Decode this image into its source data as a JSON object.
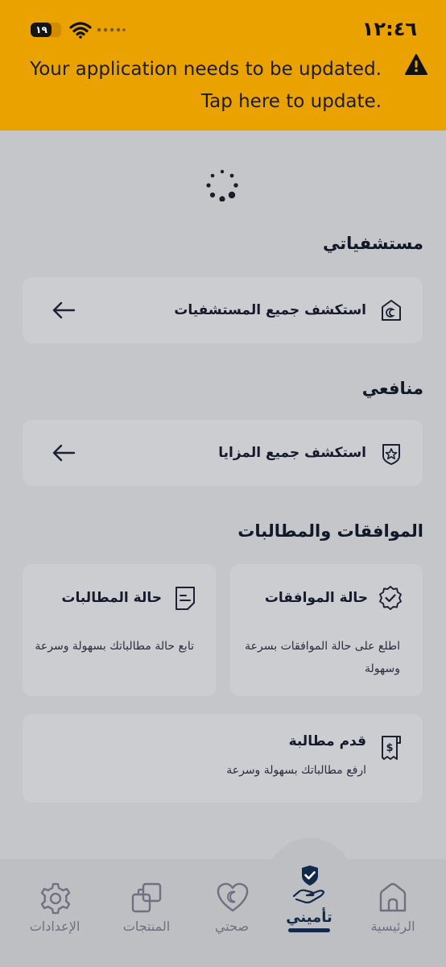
{
  "status_bar": {
    "time": "١٢:٤٦",
    "battery": "١٩"
  },
  "update_banner": {
    "line1": "Your application needs to be updated.",
    "line2": "Tap here to update."
  },
  "sections": {
    "hospitals": {
      "title": "مستشفياتي",
      "link_label": "استكشف جميع المستشفيات"
    },
    "benefits": {
      "title": "منافعي",
      "link_label": "استكشف جميع المزايا"
    },
    "approvals": {
      "title": "الموافقات والمطالبات",
      "approval_status": {
        "title": "حالة الموافقات",
        "desc": "اطلع على حالة الموافقات بسرعة وسهولة"
      },
      "claim_status": {
        "title": "حالة المطالبات",
        "desc": "تابع حالة مطالباتك بسهولة وسرعة"
      },
      "submit_claim": {
        "title": "قدم مطالبة",
        "desc": "ارفع مطالباتك بسهولة وسرعة"
      }
    }
  },
  "bottom_nav": {
    "home": "الرئيسية",
    "my_insurance": "تأميني",
    "my_health": "صحتي",
    "products": "المنتجات",
    "settings": "الإعدادات"
  },
  "colors": {
    "banner": "#e9a200",
    "accent": "#13294b",
    "overlay": "#c4c6ca"
  }
}
